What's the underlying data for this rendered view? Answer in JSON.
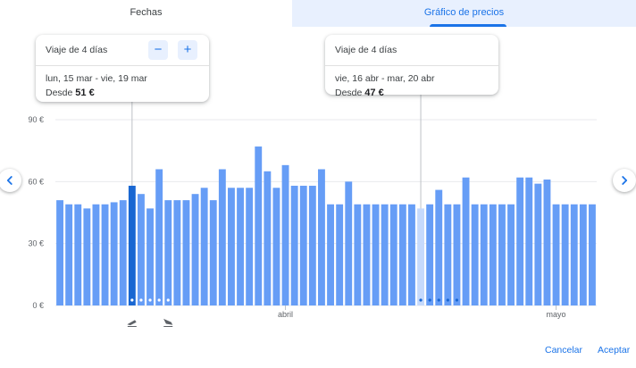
{
  "tabs": {
    "dates_label": "Fechas",
    "price_graph_label": "Gráfico de precios",
    "active": "price_graph"
  },
  "tooltip_selected": {
    "heading": "Viaje de 4 días",
    "dates": "lun, 15 mar - vie, 19 mar",
    "price_prefix": "Desde",
    "price": "51 €",
    "minus_label": "−",
    "plus_label": "+"
  },
  "tooltip_hover": {
    "heading": "Viaje de 4 días",
    "dates": "vie, 16 abr - mar, 20 abr",
    "price_prefix": "Desde",
    "price": "47 €"
  },
  "footer": {
    "cancel_label": "Cancelar",
    "accept_label": "Aceptar"
  },
  "icons": {
    "prev": "chevron-left-icon",
    "next": "chevron-right-icon",
    "departure": "flight-takeoff-icon",
    "return": "flight-land-icon"
  },
  "colors": {
    "bar": "#669df6",
    "bar_selected": "#1967d2",
    "bar_hover": "#c6dafc",
    "accent": "#1a73e8",
    "tab_active_bg": "#e8f0fe"
  },
  "chart_data": {
    "type": "bar",
    "x": [
      "2021-03-07",
      "2021-03-08",
      "2021-03-09",
      "2021-03-10",
      "2021-03-11",
      "2021-03-12",
      "2021-03-13",
      "2021-03-14",
      "2021-03-15",
      "2021-03-16",
      "2021-03-17",
      "2021-03-18",
      "2021-03-19",
      "2021-03-20",
      "2021-03-21",
      "2021-03-22",
      "2021-03-23",
      "2021-03-24",
      "2021-03-25",
      "2021-03-26",
      "2021-03-27",
      "2021-03-28",
      "2021-03-29",
      "2021-03-30",
      "2021-03-31",
      "2021-04-01",
      "2021-04-02",
      "2021-04-03",
      "2021-04-04",
      "2021-04-05",
      "2021-04-06",
      "2021-04-07",
      "2021-04-08",
      "2021-04-09",
      "2021-04-10",
      "2021-04-11",
      "2021-04-12",
      "2021-04-13",
      "2021-04-14",
      "2021-04-15",
      "2021-04-16",
      "2021-04-17",
      "2021-04-18",
      "2021-04-19",
      "2021-04-20",
      "2021-04-21",
      "2021-04-22",
      "2021-04-23",
      "2021-04-24",
      "2021-04-25",
      "2021-04-26",
      "2021-04-27",
      "2021-04-28",
      "2021-04-29",
      "2021-04-30",
      "2021-05-01",
      "2021-05-02",
      "2021-05-03",
      "2021-05-04",
      "2021-05-05"
    ],
    "values": [
      51,
      49,
      49,
      47,
      49,
      49,
      50,
      51,
      58,
      54,
      47,
      66,
      51,
      51,
      51,
      54,
      57,
      51,
      66,
      57,
      57,
      57,
      77,
      65,
      57,
      68,
      58,
      58,
      58,
      66,
      49,
      49,
      60,
      49,
      49,
      49,
      49,
      49,
      49,
      49,
      47,
      49,
      56,
      49,
      49,
      62,
      49,
      49,
      49,
      49,
      49,
      62,
      62,
      59,
      61,
      49,
      49,
      49,
      49,
      49
    ],
    "selected_index": 8,
    "hover_index": 40,
    "ylim": [
      0,
      90
    ],
    "yticks": [
      0,
      30,
      60,
      90
    ],
    "ytick_labels": [
      "0 €",
      "30 €",
      "60 €",
      "90 €"
    ],
    "month_labels": [
      {
        "label": "abril",
        "date": "2021-04-01"
      },
      {
        "label": "mayo",
        "date": "2021-05-01"
      }
    ],
    "trip_marker_range_selected": [
      8,
      12
    ],
    "trip_marker_range_hover": [
      40,
      44
    ],
    "grid": true,
    "xlabel": "",
    "ylabel": ""
  }
}
